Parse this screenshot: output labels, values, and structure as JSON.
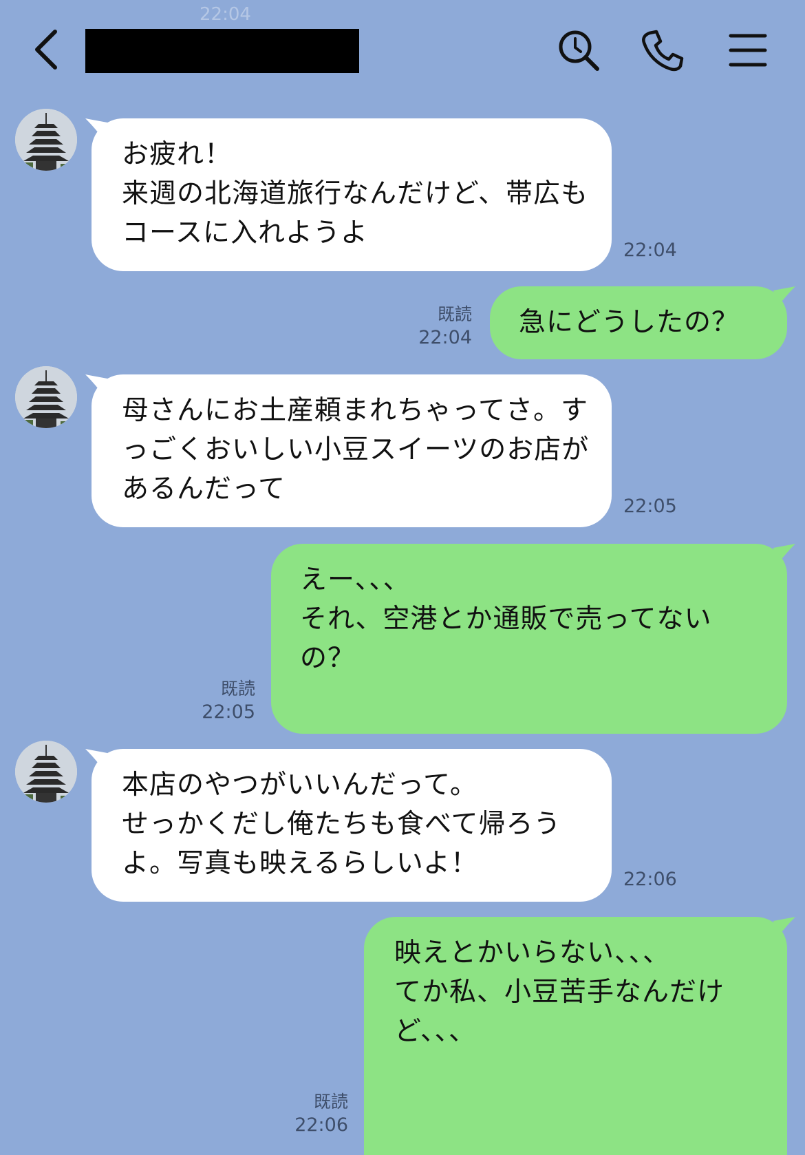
{
  "background_color": "#8eaad8",
  "header": {
    "ghost_time": "22:04",
    "icons": [
      "chevron-left-icon",
      "search-clock-icon",
      "phone-icon",
      "menu-icon"
    ]
  },
  "messages": [
    {
      "from": "them",
      "text": "お疲れ！\n来週の北海道旅行なんだけど、帯広もコースに入れようよ",
      "time": "22:04"
    },
    {
      "from": "me",
      "text": "急にどうしたの？",
      "read": "既読",
      "time": "22:04"
    },
    {
      "from": "them",
      "text": "母さんにお土産頼まれちゃってさ。すっごくおいしい小豆スイーツのお店があるんだって",
      "time": "22:05"
    },
    {
      "from": "me",
      "text": "えー、、、\nそれ、空港とか通販で売ってないの？",
      "read": "既読",
      "time": "22:05"
    },
    {
      "from": "them",
      "text": "本店のやつがいいんだって。\nせっかくだし俺たちも食べて帰ろうよ。写真も映えるらしいよ！",
      "time": "22:06"
    },
    {
      "from": "me",
      "text": "映えとかいらない、、、\nてか私、小豆苦手なんだけど、、、",
      "read": "既読",
      "time": "22:06"
    }
  ],
  "colors": {
    "incoming_bubble": "#ffffff",
    "outgoing_bubble": "#8de384",
    "meta_text": "#3e4e6a"
  }
}
